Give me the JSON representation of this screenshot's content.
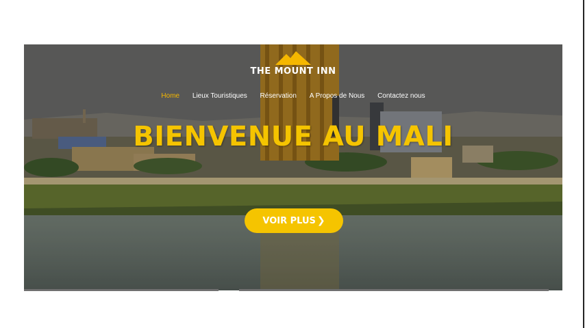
{
  "logo": {
    "text": "THE MOUNT INN",
    "icon": "mountain-logo-icon"
  },
  "nav": {
    "items": [
      {
        "label": "Home",
        "active": true
      },
      {
        "label": "Lieux Touristiques",
        "active": false
      },
      {
        "label": "Réservation",
        "active": false
      },
      {
        "label": "A Propos de Nous",
        "active": false
      },
      {
        "label": "Contactez nous",
        "active": false
      }
    ]
  },
  "hero": {
    "headline": "BIENVENUE AU MALI",
    "cta_label": "VOIR PLUS",
    "cta_icon": "chevron-right-icon"
  },
  "colors": {
    "accent": "#f5c400",
    "nav_active": "#f5b700",
    "text_light": "#ffffff"
  }
}
